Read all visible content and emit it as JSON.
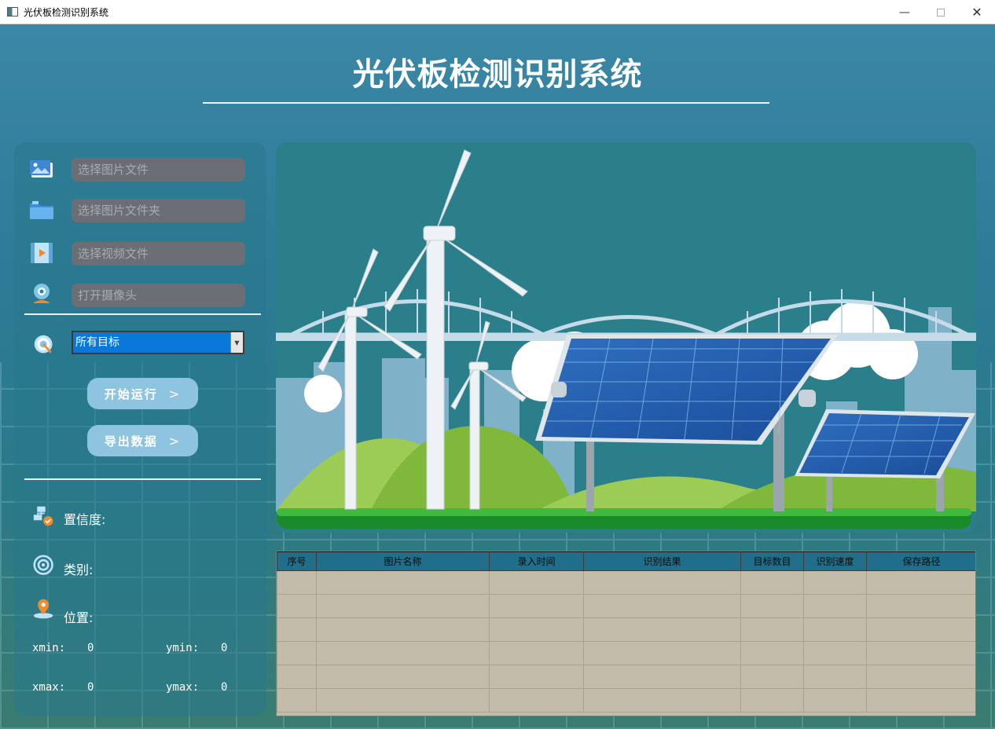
{
  "window": {
    "title": "光伏板检测识别系统"
  },
  "header": {
    "title": "光伏板检测识别系统"
  },
  "left_panel": {
    "inputs": [
      {
        "icon": "image-file-icon",
        "placeholder": "选择图片文件"
      },
      {
        "icon": "folder-icon",
        "placeholder": "选择图片文件夹"
      },
      {
        "icon": "video-file-icon",
        "placeholder": "选择视频文件"
      },
      {
        "icon": "webcam-icon",
        "placeholder": "打开摄像头"
      }
    ],
    "target_select": {
      "icon": "target-icon",
      "value": "所有目标"
    },
    "buttons": {
      "start": "开始运行",
      "export": "导出数据",
      "chevron": ">"
    },
    "info": {
      "confidence_label": "置信度:",
      "class_label": "类别:",
      "position_label": "位置:",
      "xmin_label": "xmin:",
      "xmin_value": "0",
      "ymin_label": "ymin:",
      "ymin_value": "0",
      "xmax_label": "xmax:",
      "xmax_value": "0",
      "ymax_label": "ymax:",
      "ymax_value": "0"
    }
  },
  "table": {
    "columns": [
      "序号",
      "图片名称",
      "录入时间",
      "识别结果",
      "目标数目",
      "识别速度",
      "保存路径"
    ],
    "row_count": 6
  },
  "colors": {
    "accent_select": "#0a78d8",
    "button": "#8ec4e0",
    "table_header": "#1f6f8a",
    "table_body": "#c4bcaa"
  }
}
